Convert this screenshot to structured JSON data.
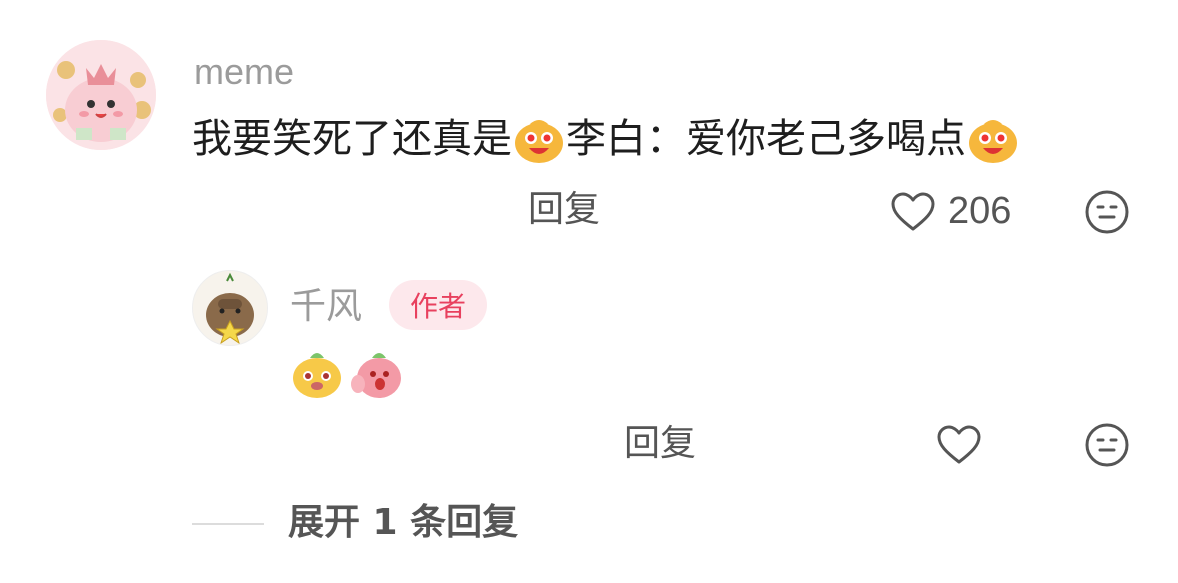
{
  "comment": {
    "username": "meme",
    "text_part1": "我要笑死了还真是",
    "text_part2": "李白：爱你老己多喝点",
    "emoji_icon": "grinning-bun-emoji",
    "reply_label": "回复",
    "like_count": "206"
  },
  "reply": {
    "username": "千风",
    "badge": "作者",
    "emojis": [
      "yellow-bun-emoji",
      "pink-bun-emoji"
    ],
    "reply_label": "回复"
  },
  "expand": {
    "label": "展开 1 条回复"
  },
  "colors": {
    "badge_bg": "#fde8ec",
    "badge_text": "#e8405e",
    "username": "#9b9b9b"
  }
}
